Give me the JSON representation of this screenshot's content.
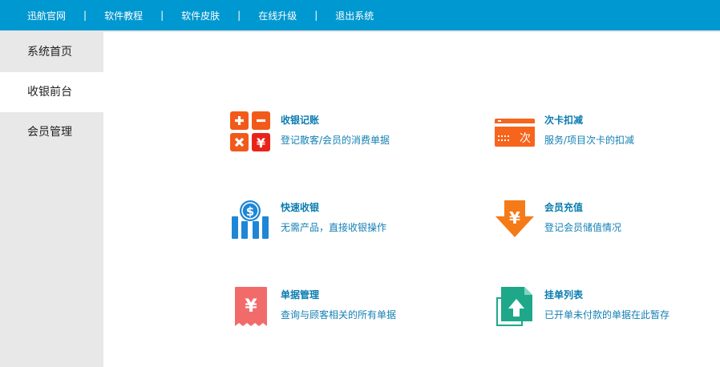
{
  "header": {
    "nav": [
      {
        "label": "迅航官网"
      },
      {
        "label": "软件教程"
      },
      {
        "label": "软件皮肤"
      },
      {
        "label": "在线升级"
      },
      {
        "label": "退出系统"
      }
    ],
    "separator": "|"
  },
  "sidebar": {
    "items": [
      {
        "label": "系统首页"
      },
      {
        "label": "收银前台",
        "active": true
      },
      {
        "label": "会员管理"
      }
    ]
  },
  "main": {
    "cards": [
      {
        "title": "收银记账",
        "desc": "登记散客/会员的消费单据",
        "icon": "calculator-icon",
        "color": "#f25a1a"
      },
      {
        "title": "次卡扣减",
        "desc": "服务/项目次卡的扣减",
        "icon": "count-card-icon",
        "color": "#f7641c"
      },
      {
        "title": "快速收银",
        "desc": "无需产品，直接收银操作",
        "icon": "dollar-chart-icon",
        "color": "#1e86d6"
      },
      {
        "title": "会员充值",
        "desc": "登记会员储值情况",
        "icon": "yen-arrow-down-icon",
        "color": "#f57a18"
      },
      {
        "title": "单据管理",
        "desc": "查询与顾客相关的所有单据",
        "icon": "yen-receipt-icon",
        "color": "#f26b6b"
      },
      {
        "title": "挂单列表",
        "desc": "已开单未付款的单据在此暂存",
        "icon": "upload-document-icon",
        "color": "#1ea889"
      }
    ],
    "icon_text": {
      "count_card": "次",
      "yen": "¥",
      "dollar": "$"
    }
  }
}
